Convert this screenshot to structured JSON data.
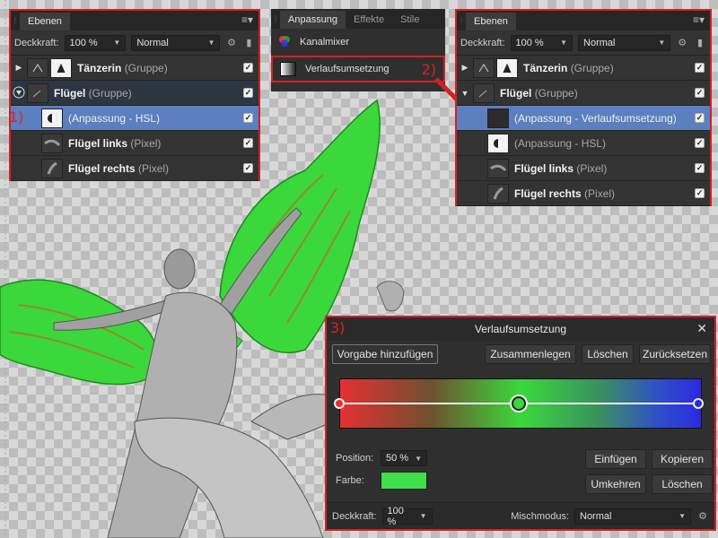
{
  "colors": {
    "accent_red": "#d42020",
    "selection_blue": "#5b7fbf",
    "wing_green": "#3ee04a",
    "panel_bg": "#2f2f2f"
  },
  "layers_before": {
    "tab": "Ebenen",
    "opacity_label": "Deckkraft:",
    "opacity_value": "100 %",
    "blend_mode": "Normal",
    "step": "1)",
    "rows": [
      {
        "name": "Tänzerin",
        "type": "(Gruppe)"
      },
      {
        "name": "Flügel",
        "type": "(Gruppe)"
      },
      {
        "name": "(Anpassung - HSL)",
        "type": ""
      },
      {
        "name": "Flügel links",
        "type": "(Pixel)"
      },
      {
        "name": "Flügel rechts",
        "type": "(Pixel)"
      }
    ]
  },
  "adjust_panel": {
    "tabs": [
      "Anpassung",
      "Effekte",
      "Stile"
    ],
    "item_channel_mixer": "Kanalmixer",
    "item_gradient_map": "Verlaufsumsetzung",
    "step": "2)"
  },
  "layers_after": {
    "tab": "Ebenen",
    "opacity_label": "Deckkraft:",
    "opacity_value": "100 %",
    "blend_mode": "Normal",
    "rows": [
      {
        "name": "Tänzerin",
        "type": "(Gruppe)"
      },
      {
        "name": "Flügel",
        "type": "(Gruppe)"
      },
      {
        "name": "(Anpassung - Verlaufsumsetzung)",
        "type": ""
      },
      {
        "name": "(Anpassung - HSL)",
        "type": ""
      },
      {
        "name": "Flügel links",
        "type": "(Pixel)"
      },
      {
        "name": "Flügel rechts",
        "type": "(Pixel)"
      }
    ]
  },
  "gradient_dialog": {
    "title": "Verlaufsumsetzung",
    "step": "3)",
    "buttons": {
      "add_preset": "Vorgabe hinzufügen",
      "merge": "Zusammenlegen",
      "delete": "Löschen",
      "reset": "Zurücksetzen",
      "insert": "Einfügen",
      "copy": "Kopieren",
      "reverse": "Umkehren",
      "delete2": "Löschen"
    },
    "position_label": "Position:",
    "position_value": "50 %",
    "color_label": "Farbe:",
    "opacity_label": "Deckkraft:",
    "opacity_value": "100 %",
    "blend_label": "Mischmodus:",
    "blend_value": "Normal"
  }
}
